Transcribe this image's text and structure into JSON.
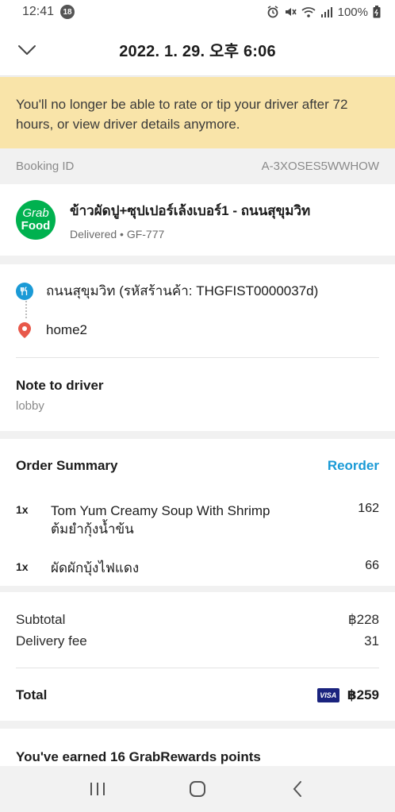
{
  "status_bar": {
    "time": "12:41",
    "notification_count": "18",
    "battery": "100%",
    "icons": [
      "alarm-icon",
      "mute-icon",
      "wifi-icon",
      "signal-icon",
      "battery-icon"
    ]
  },
  "header": {
    "title": "2022. 1. 29. 오후 6:06",
    "back_icon": "chevron-down-icon"
  },
  "banner": {
    "text": "You'll no longer be able to rate or tip your driver after 72 hours, or view driver details anymore."
  },
  "booking": {
    "label": "Booking ID",
    "value": "A-3XOSES5WWHOW"
  },
  "merchant": {
    "logo_line1": "Grab",
    "logo_line2": "Food",
    "name": "ข้าวผัดปู+ซุปเปอร์เล้งเบอร์1 - ถนนสุขุมวิท",
    "status": "Delivered • GF-777"
  },
  "route": {
    "pickup": "ถนนสุขุมวิท (รหัสร้านค้า: THGFIST0000037d)",
    "dropoff": "home2",
    "note_title": "Note to driver",
    "note_text": "lobby"
  },
  "order": {
    "heading": "Order Summary",
    "reorder_label": "Reorder",
    "items": [
      {
        "qty": "1x",
        "name": "Tom Yum Creamy Soup With Shrimp",
        "name_alt": "ต้มยำกุ้งน้ำข้น",
        "price": "162"
      },
      {
        "qty": "1x",
        "name": "ผัดผักบุ้งไฟแดง",
        "name_alt": "",
        "price": "66"
      }
    ]
  },
  "totals": {
    "subtotal_label": "Subtotal",
    "subtotal_value": "฿228",
    "delivery_label": "Delivery fee",
    "delivery_value": "31",
    "total_label": "Total",
    "payment_badge": "VISA",
    "total_value": "฿259"
  },
  "rewards": {
    "text": "You've earned 16 GrabRewards points"
  },
  "colors": {
    "banner_bg": "#f9e4a9",
    "accent_blue": "#1a9ad6",
    "grab_green": "#00b14f",
    "pin_red": "#e8584a"
  }
}
